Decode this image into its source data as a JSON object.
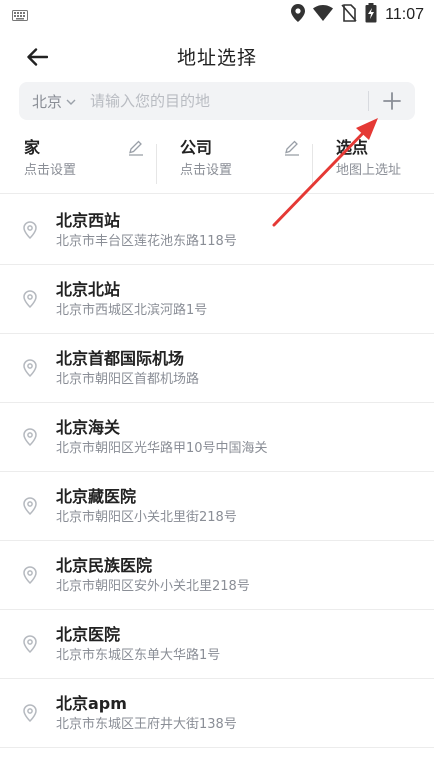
{
  "status_bar": {
    "time": "11:07",
    "icons": [
      "keyboard-icon",
      "location-icon",
      "wifi-icon",
      "no-sim-icon",
      "battery-charging-icon"
    ]
  },
  "header": {
    "title": "地址选择",
    "back_icon": "arrow-left-icon"
  },
  "search": {
    "city": "北京",
    "placeholder": "请输入您的目的地",
    "add_icon": "plus-icon"
  },
  "quick": [
    {
      "title": "家",
      "subtitle": "点击设置",
      "editable": true
    },
    {
      "title": "公司",
      "subtitle": "点击设置",
      "editable": true
    },
    {
      "title": "选点",
      "subtitle": "地图上选址",
      "editable": false
    }
  ],
  "places": [
    {
      "name": "北京西站",
      "address": "北京市丰台区莲花池东路118号"
    },
    {
      "name": "北京北站",
      "address": "北京市西城区北滨河路1号"
    },
    {
      "name": "北京首都国际机场",
      "address": "北京市朝阳区首都机场路"
    },
    {
      "name": "北京海关",
      "address": "北京市朝阳区光华路甲10号中国海关"
    },
    {
      "name": "北京藏医院",
      "address": "北京市朝阳区小关北里街218号"
    },
    {
      "name": "北京民族医院",
      "address": "北京市朝阳区安外小关北里218号"
    },
    {
      "name": "北京医院",
      "address": "北京市东城区东单大华路1号"
    },
    {
      "name": "北京apm",
      "address": "北京市东城区王府井大街138号"
    }
  ],
  "colors": {
    "annotation_arrow": "#e53935",
    "secondary_text": "#8a8e96",
    "search_bg": "#f2f3f5"
  }
}
